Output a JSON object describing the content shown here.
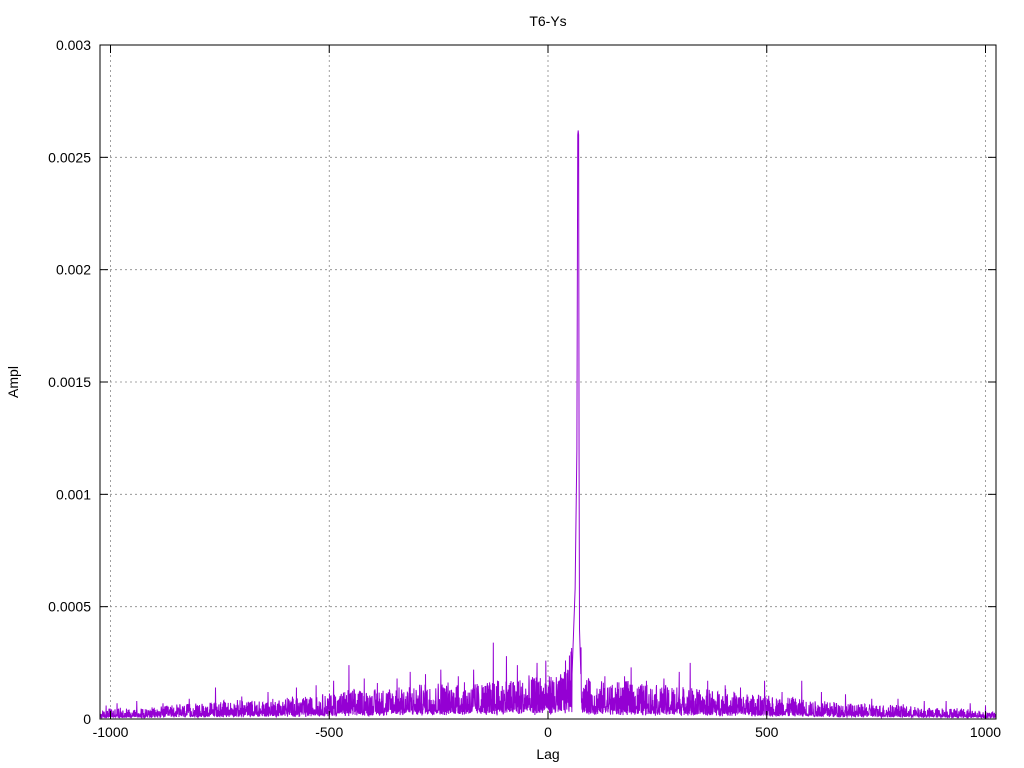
{
  "chart_data": {
    "type": "line",
    "title": "T6-Ys",
    "xlabel": "Lag",
    "ylabel": "Ampl",
    "xlim": [
      -1024,
      1024
    ],
    "ylim": [
      0,
      0.003
    ],
    "x_ticks": [
      -1000,
      -500,
      0,
      500,
      1000
    ],
    "x_tick_labels": [
      "-1000",
      "-500",
      "0",
      "500",
      "1000"
    ],
    "y_ticks": [
      0,
      0.0005,
      0.001,
      0.0015,
      0.002,
      0.0025,
      0.003
    ],
    "y_tick_labels": [
      "0",
      "0.0005",
      "0.001",
      "0.0015",
      "0.002",
      "0.0025",
      "0.003"
    ],
    "grid": true,
    "line_color": "#9400d3",
    "series": [
      {
        "x": [
          -1024,
          -1000,
          -950,
          -900,
          -850,
          -800,
          -750,
          -700,
          -650,
          -600,
          -550,
          -500,
          -450,
          -400,
          -350,
          -300,
          -250,
          -200,
          -150,
          -100,
          -50,
          0,
          30,
          55,
          62,
          66,
          68,
          69,
          70,
          71,
          72,
          75,
          80,
          100,
          150,
          200,
          250,
          300,
          350,
          400,
          450,
          500,
          550,
          600,
          650,
          700,
          750,
          800,
          850,
          900,
          950,
          1000,
          1024
        ],
        "values": [
          2e-05,
          3e-05,
          3e-05,
          3e-05,
          4e-05,
          4e-05,
          5e-05,
          5e-05,
          5e-05,
          6e-05,
          6e-05,
          7e-05,
          8e-05,
          8e-05,
          9e-05,
          9e-05,
          0.0001,
          0.0001,
          0.0001,
          0.00011,
          0.00011,
          0.00012,
          0.00012,
          0.0002,
          0.00058,
          0.0012,
          0.0026,
          0.00262,
          0.0026,
          0.0012,
          0.0004,
          0.0002,
          0.00012,
          0.0001,
          0.0001,
          0.0001,
          9e-05,
          9e-05,
          8e-05,
          8e-05,
          7e-05,
          6e-05,
          6e-05,
          5e-05,
          5e-05,
          4e-05,
          4e-05,
          4e-05,
          3e-05,
          3e-05,
          3e-05,
          2e-05,
          2e-05
        ],
        "noise_peaks": [
          [
            -1010,
            6e-05
          ],
          [
            -985,
            7e-05
          ],
          [
            -940,
            8e-05
          ],
          [
            -880,
            7e-05
          ],
          [
            -820,
            9e-05
          ],
          [
            -760,
            0.00014
          ],
          [
            -700,
            0.0001
          ],
          [
            -640,
            0.00012
          ],
          [
            -575,
            0.00014
          ],
          [
            -530,
            0.00015
          ],
          [
            -490,
            0.00017
          ],
          [
            -455,
            0.00024
          ],
          [
            -420,
            0.00018
          ],
          [
            -390,
            0.00016
          ],
          [
            -345,
            0.00018
          ],
          [
            -315,
            0.00021
          ],
          [
            -280,
            0.0002
          ],
          [
            -245,
            0.00022
          ],
          [
            -205,
            0.00019
          ],
          [
            -170,
            0.00022
          ],
          [
            -125,
            0.00034
          ],
          [
            -95,
            0.00028
          ],
          [
            -70,
            0.00024
          ],
          [
            -25,
            0.00025
          ],
          [
            -5,
            0.00026
          ],
          [
            35,
            0.00018
          ],
          [
            95,
            0.00017
          ],
          [
            130,
            0.00019
          ],
          [
            175,
            0.00019
          ],
          [
            190,
            0.00023
          ],
          [
            225,
            0.00017
          ],
          [
            265,
            0.00018
          ],
          [
            300,
            0.00021
          ],
          [
            325,
            0.00025
          ],
          [
            365,
            0.00017
          ],
          [
            405,
            0.00015
          ],
          [
            440,
            0.00014
          ],
          [
            495,
            0.00017
          ],
          [
            535,
            0.00012
          ],
          [
            580,
            0.00017
          ],
          [
            625,
            0.00012
          ],
          [
            680,
            0.00011
          ],
          [
            740,
            9e-05
          ],
          [
            800,
            9e-05
          ],
          [
            860,
            8e-05
          ],
          [
            910,
            8e-05
          ],
          [
            965,
            7e-05
          ],
          [
            1000,
            6e-05
          ]
        ]
      }
    ]
  }
}
